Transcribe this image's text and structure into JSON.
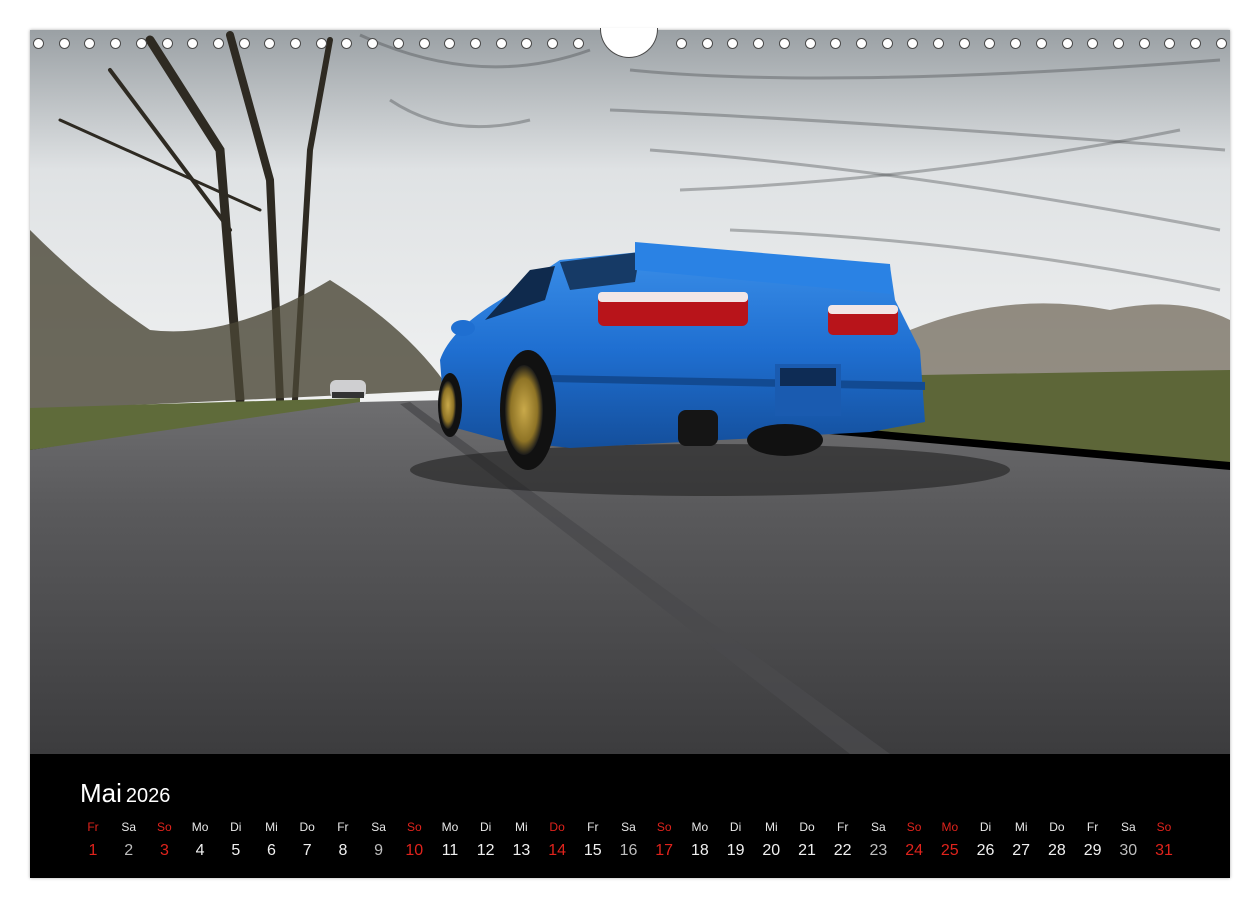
{
  "calendar": {
    "month": "Mai",
    "year": "2026",
    "days": [
      {
        "name": "Fr",
        "num": "1",
        "type": "red"
      },
      {
        "name": "Sa",
        "num": "2",
        "type": "sat"
      },
      {
        "name": "So",
        "num": "3",
        "type": "red"
      },
      {
        "name": "Mo",
        "num": "4",
        "type": "normal"
      },
      {
        "name": "Di",
        "num": "5",
        "type": "normal"
      },
      {
        "name": "Mi",
        "num": "6",
        "type": "normal"
      },
      {
        "name": "Do",
        "num": "7",
        "type": "normal"
      },
      {
        "name": "Fr",
        "num": "8",
        "type": "normal"
      },
      {
        "name": "Sa",
        "num": "9",
        "type": "sat"
      },
      {
        "name": "So",
        "num": "10",
        "type": "red"
      },
      {
        "name": "Mo",
        "num": "11",
        "type": "normal"
      },
      {
        "name": "Di",
        "num": "12",
        "type": "normal"
      },
      {
        "name": "Mi",
        "num": "13",
        "type": "normal"
      },
      {
        "name": "Do",
        "num": "14",
        "type": "red"
      },
      {
        "name": "Fr",
        "num": "15",
        "type": "normal"
      },
      {
        "name": "Sa",
        "num": "16",
        "type": "sat"
      },
      {
        "name": "So",
        "num": "17",
        "type": "red"
      },
      {
        "name": "Mo",
        "num": "18",
        "type": "normal"
      },
      {
        "name": "Di",
        "num": "19",
        "type": "normal"
      },
      {
        "name": "Mi",
        "num": "20",
        "type": "normal"
      },
      {
        "name": "Do",
        "num": "21",
        "type": "normal"
      },
      {
        "name": "Fr",
        "num": "22",
        "type": "normal"
      },
      {
        "name": "Sa",
        "num": "23",
        "type": "sat"
      },
      {
        "name": "So",
        "num": "24",
        "type": "red"
      },
      {
        "name": "Mo",
        "num": "25",
        "type": "red"
      },
      {
        "name": "Di",
        "num": "26",
        "type": "normal"
      },
      {
        "name": "Mi",
        "num": "27",
        "type": "normal"
      },
      {
        "name": "Do",
        "num": "28",
        "type": "normal"
      },
      {
        "name": "Fr",
        "num": "29",
        "type": "normal"
      },
      {
        "name": "Sa",
        "num": "30",
        "type": "sat"
      },
      {
        "name": "So",
        "num": "31",
        "type": "red"
      }
    ]
  },
  "colors": {
    "holiday_red": "#e0231c",
    "car_blue": "#1f6fd1",
    "band_black": "#000000"
  }
}
